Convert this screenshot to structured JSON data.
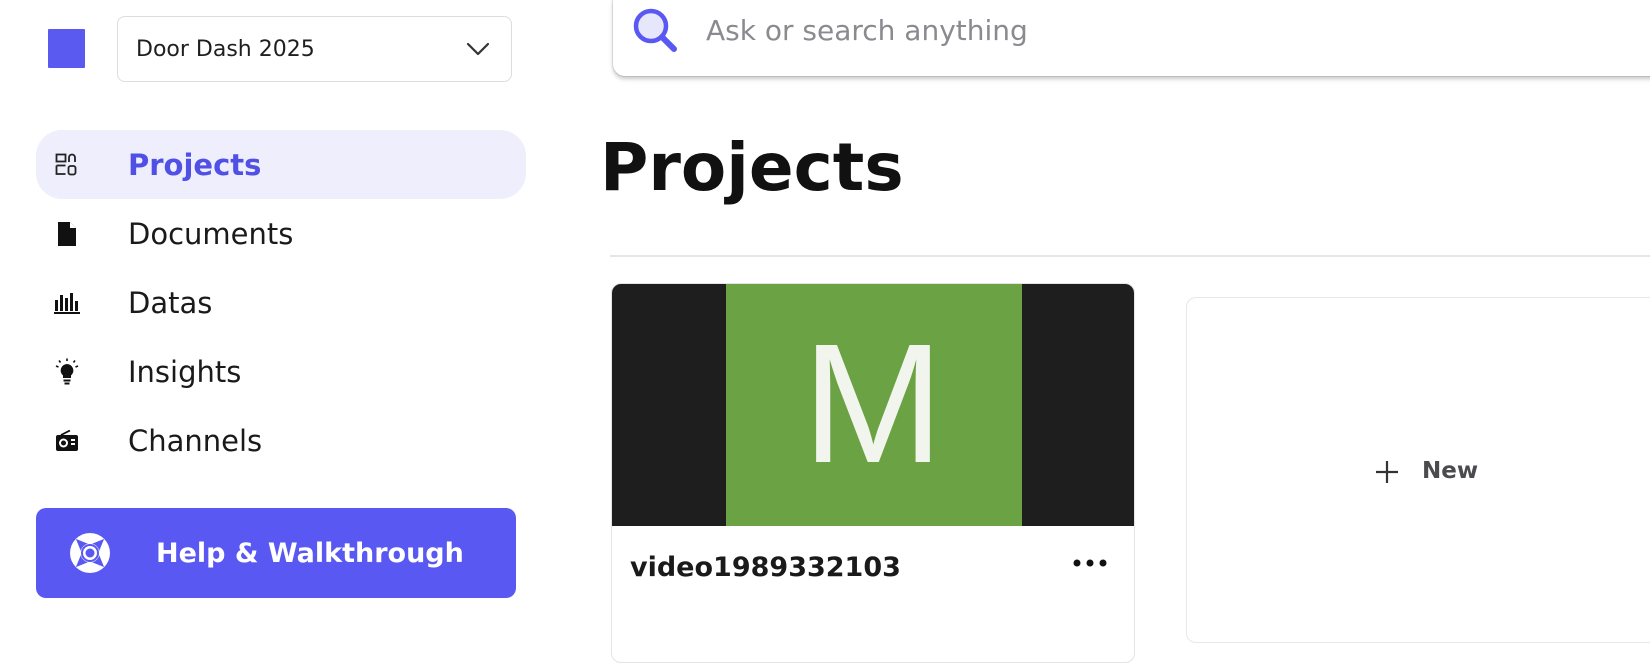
{
  "workspace": {
    "selected": "Door Dash 2025"
  },
  "sidebar": {
    "items": [
      {
        "label": "Projects",
        "icon": "projects-grid-icon",
        "active": true
      },
      {
        "label": "Documents",
        "icon": "document-icon",
        "active": false
      },
      {
        "label": "Datas",
        "icon": "bar-chart-icon",
        "active": false
      },
      {
        "label": "Insights",
        "icon": "lightbulb-icon",
        "active": false
      },
      {
        "label": "Channels",
        "icon": "radio-icon",
        "active": false
      }
    ],
    "help_button": {
      "label": "Help & Walkthrough",
      "icon": "lifebuoy-icon"
    }
  },
  "search": {
    "placeholder": "Ask or search anything",
    "icon": "search-icon"
  },
  "main": {
    "title": "Projects",
    "projects": [
      {
        "name": "video1989332103",
        "thumbnail_letter": "M",
        "menu_icon": "more-horizontal-icon"
      }
    ],
    "new_card": {
      "label": "New",
      "icon": "plus-icon"
    }
  },
  "colors": {
    "accent": "#5a58f2",
    "active_nav_bg": "#eeeefc",
    "active_nav_text": "#5050e6",
    "thumbnail_green": "#6aa244",
    "thumbnail_dark": "#1e1e1e"
  }
}
